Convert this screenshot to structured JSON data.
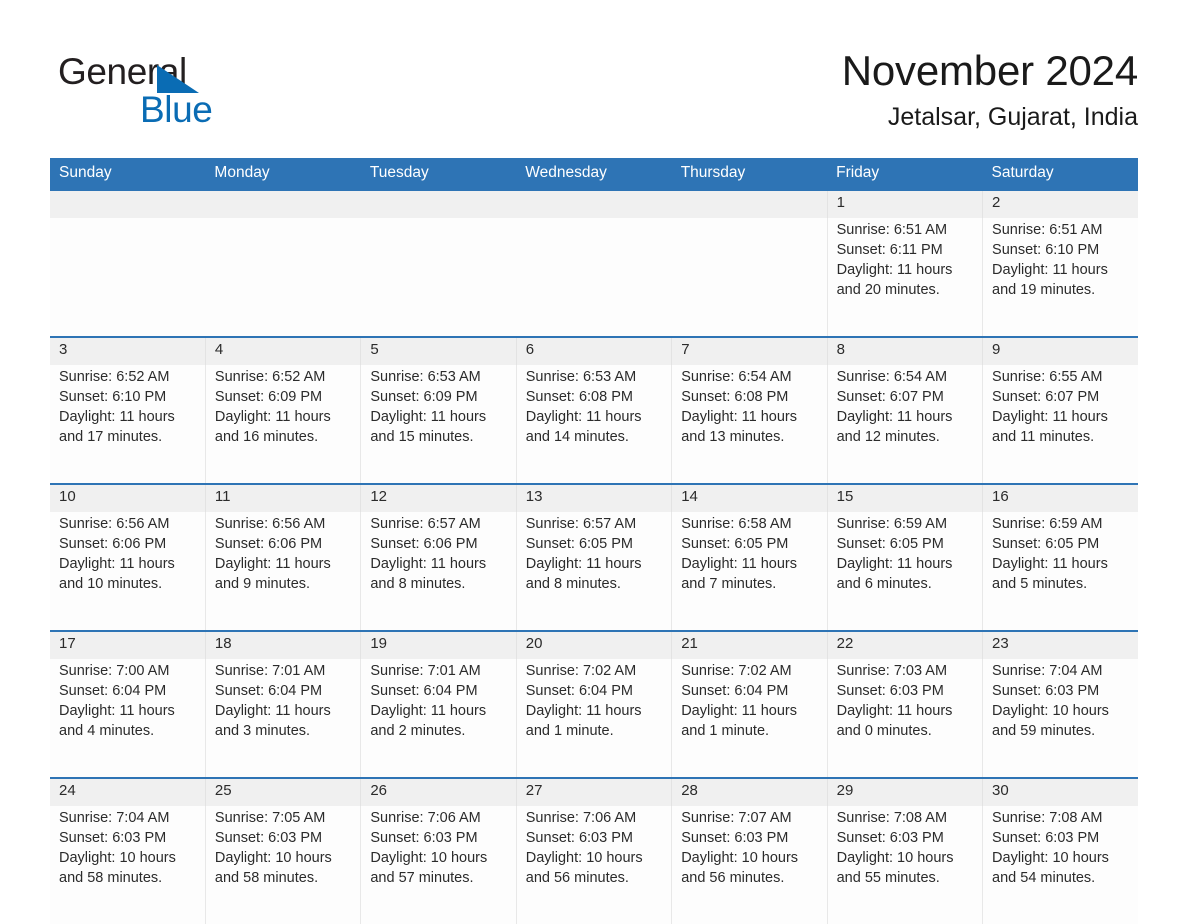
{
  "brand": {
    "word_one": "General",
    "word_two": "Blue",
    "triangle_icon": "brand-triangle-icon",
    "accent_color": "#0a6cb4",
    "text_color": "#231f20"
  },
  "header": {
    "title": "November 2024",
    "subtitle": "Jetalsar, Gujarat, India"
  },
  "theme": {
    "header_blue": "#2e74b5",
    "daynum_band": "#f0f0f0",
    "cell_bg": "#fdfdfd",
    "text": "#2b2b2b"
  },
  "calendar": {
    "weekday_headers": [
      "Sunday",
      "Monday",
      "Tuesday",
      "Wednesday",
      "Thursday",
      "Friday",
      "Saturday"
    ],
    "labels": {
      "sunrise": "Sunrise:",
      "sunset": "Sunset:",
      "daylight": "Daylight:"
    },
    "weeks": [
      [
        {
          "blank": true
        },
        {
          "blank": true
        },
        {
          "blank": true
        },
        {
          "blank": true
        },
        {
          "blank": true
        },
        {
          "day": "1",
          "sunrise": "Sunrise: 6:51 AM",
          "sunset": "Sunset: 6:11 PM",
          "daylight": "Daylight: 11 hours and 20 minutes."
        },
        {
          "day": "2",
          "sunrise": "Sunrise: 6:51 AM",
          "sunset": "Sunset: 6:10 PM",
          "daylight": "Daylight: 11 hours and 19 minutes."
        }
      ],
      [
        {
          "day": "3",
          "sunrise": "Sunrise: 6:52 AM",
          "sunset": "Sunset: 6:10 PM",
          "daylight": "Daylight: 11 hours and 17 minutes."
        },
        {
          "day": "4",
          "sunrise": "Sunrise: 6:52 AM",
          "sunset": "Sunset: 6:09 PM",
          "daylight": "Daylight: 11 hours and 16 minutes."
        },
        {
          "day": "5",
          "sunrise": "Sunrise: 6:53 AM",
          "sunset": "Sunset: 6:09 PM",
          "daylight": "Daylight: 11 hours and 15 minutes."
        },
        {
          "day": "6",
          "sunrise": "Sunrise: 6:53 AM",
          "sunset": "Sunset: 6:08 PM",
          "daylight": "Daylight: 11 hours and 14 minutes."
        },
        {
          "day": "7",
          "sunrise": "Sunrise: 6:54 AM",
          "sunset": "Sunset: 6:08 PM",
          "daylight": "Daylight: 11 hours and 13 minutes."
        },
        {
          "day": "8",
          "sunrise": "Sunrise: 6:54 AM",
          "sunset": "Sunset: 6:07 PM",
          "daylight": "Daylight: 11 hours and 12 minutes."
        },
        {
          "day": "9",
          "sunrise": "Sunrise: 6:55 AM",
          "sunset": "Sunset: 6:07 PM",
          "daylight": "Daylight: 11 hours and 11 minutes."
        }
      ],
      [
        {
          "day": "10",
          "sunrise": "Sunrise: 6:56 AM",
          "sunset": "Sunset: 6:06 PM",
          "daylight": "Daylight: 11 hours and 10 minutes."
        },
        {
          "day": "11",
          "sunrise": "Sunrise: 6:56 AM",
          "sunset": "Sunset: 6:06 PM",
          "daylight": "Daylight: 11 hours and 9 minutes."
        },
        {
          "day": "12",
          "sunrise": "Sunrise: 6:57 AM",
          "sunset": "Sunset: 6:06 PM",
          "daylight": "Daylight: 11 hours and 8 minutes."
        },
        {
          "day": "13",
          "sunrise": "Sunrise: 6:57 AM",
          "sunset": "Sunset: 6:05 PM",
          "daylight": "Daylight: 11 hours and 8 minutes."
        },
        {
          "day": "14",
          "sunrise": "Sunrise: 6:58 AM",
          "sunset": "Sunset: 6:05 PM",
          "daylight": "Daylight: 11 hours and 7 minutes."
        },
        {
          "day": "15",
          "sunrise": "Sunrise: 6:59 AM",
          "sunset": "Sunset: 6:05 PM",
          "daylight": "Daylight: 11 hours and 6 minutes."
        },
        {
          "day": "16",
          "sunrise": "Sunrise: 6:59 AM",
          "sunset": "Sunset: 6:05 PM",
          "daylight": "Daylight: 11 hours and 5 minutes."
        }
      ],
      [
        {
          "day": "17",
          "sunrise": "Sunrise: 7:00 AM",
          "sunset": "Sunset: 6:04 PM",
          "daylight": "Daylight: 11 hours and 4 minutes."
        },
        {
          "day": "18",
          "sunrise": "Sunrise: 7:01 AM",
          "sunset": "Sunset: 6:04 PM",
          "daylight": "Daylight: 11 hours and 3 minutes."
        },
        {
          "day": "19",
          "sunrise": "Sunrise: 7:01 AM",
          "sunset": "Sunset: 6:04 PM",
          "daylight": "Daylight: 11 hours and 2 minutes."
        },
        {
          "day": "20",
          "sunrise": "Sunrise: 7:02 AM",
          "sunset": "Sunset: 6:04 PM",
          "daylight": "Daylight: 11 hours and 1 minute."
        },
        {
          "day": "21",
          "sunrise": "Sunrise: 7:02 AM",
          "sunset": "Sunset: 6:04 PM",
          "daylight": "Daylight: 11 hours and 1 minute."
        },
        {
          "day": "22",
          "sunrise": "Sunrise: 7:03 AM",
          "sunset": "Sunset: 6:03 PM",
          "daylight": "Daylight: 11 hours and 0 minutes."
        },
        {
          "day": "23",
          "sunrise": "Sunrise: 7:04 AM",
          "sunset": "Sunset: 6:03 PM",
          "daylight": "Daylight: 10 hours and 59 minutes."
        }
      ],
      [
        {
          "day": "24",
          "sunrise": "Sunrise: 7:04 AM",
          "sunset": "Sunset: 6:03 PM",
          "daylight": "Daylight: 10 hours and 58 minutes."
        },
        {
          "day": "25",
          "sunrise": "Sunrise: 7:05 AM",
          "sunset": "Sunset: 6:03 PM",
          "daylight": "Daylight: 10 hours and 58 minutes."
        },
        {
          "day": "26",
          "sunrise": "Sunrise: 7:06 AM",
          "sunset": "Sunset: 6:03 PM",
          "daylight": "Daylight: 10 hours and 57 minutes."
        },
        {
          "day": "27",
          "sunrise": "Sunrise: 7:06 AM",
          "sunset": "Sunset: 6:03 PM",
          "daylight": "Daylight: 10 hours and 56 minutes."
        },
        {
          "day": "28",
          "sunrise": "Sunrise: 7:07 AM",
          "sunset": "Sunset: 6:03 PM",
          "daylight": "Daylight: 10 hours and 56 minutes."
        },
        {
          "day": "29",
          "sunrise": "Sunrise: 7:08 AM",
          "sunset": "Sunset: 6:03 PM",
          "daylight": "Daylight: 10 hours and 55 minutes."
        },
        {
          "day": "30",
          "sunrise": "Sunrise: 7:08 AM",
          "sunset": "Sunset: 6:03 PM",
          "daylight": "Daylight: 10 hours and 54 minutes."
        }
      ]
    ]
  }
}
